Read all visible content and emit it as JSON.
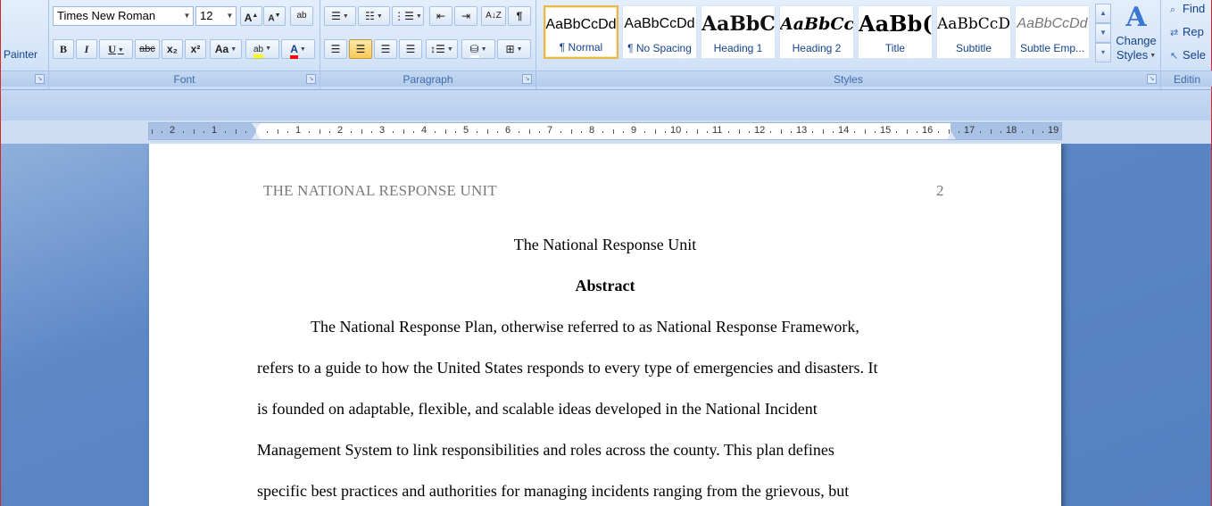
{
  "clipboard": {
    "painter_label": "Painter"
  },
  "font": {
    "group_label": "Font",
    "family": "Times New Roman",
    "size": "12",
    "grow_label": "A",
    "shrink_label": "A",
    "clear_label": "ab",
    "bold": "B",
    "italic": "I",
    "underline": "U",
    "strike": "abc",
    "subscript": "x₂",
    "superscript": "x²",
    "case": "Aa",
    "highlight": "ab",
    "font_color": "A",
    "highlight_color": "#ffff00",
    "font_color_value": "#ff0000"
  },
  "paragraph": {
    "group_label": "Paragraph",
    "pilcrow": "¶",
    "sort": "A↓Z"
  },
  "styles": {
    "group_label": "Styles",
    "items": [
      {
        "preview": "AaBbCcDd",
        "name": "¶ Normal"
      },
      {
        "preview": "AaBbCcDd",
        "name": "¶ No Spacing"
      },
      {
        "preview": "AaBbC(",
        "name": "Heading 1"
      },
      {
        "preview": "AaBbCc",
        "name": "Heading 2"
      },
      {
        "preview": "AaBb(",
        "name": "Title"
      },
      {
        "preview": "AaBbCcD",
        "name": "Subtitle"
      },
      {
        "preview": "AaBbCcDd",
        "name": "Subtle Emp..."
      }
    ],
    "change_styles_line1": "Change",
    "change_styles_line2": "Styles"
  },
  "editing": {
    "group_label": "Editin",
    "find": "Find",
    "replace": "Rep",
    "select": "Sele"
  },
  "ruler": {
    "labels": [
      "2",
      "1",
      "1",
      "2",
      "3",
      "4",
      "5",
      "6",
      "7",
      "8",
      "9",
      "10",
      "11",
      "12",
      "13",
      "14",
      "15",
      "16",
      "17",
      "18",
      "19"
    ]
  },
  "document": {
    "header_left": "THE NATIONAL  RESPONSE  UNIT",
    "page_number": "2",
    "title": "The National Response Unit",
    "abstract_heading": "Abstract",
    "lines": [
      "The National Response Plan, otherwise referred to as National Response Framework,",
      "refers to a guide to how the United States responds to every type of emergencies and disasters. It",
      "is founded on adaptable, flexible, and scalable ideas developed in the National Incident",
      "Management System to link responsibilities and roles across the county. This plan defines",
      "specific best practices and authorities for managing incidents ranging from the grievous, but"
    ]
  }
}
